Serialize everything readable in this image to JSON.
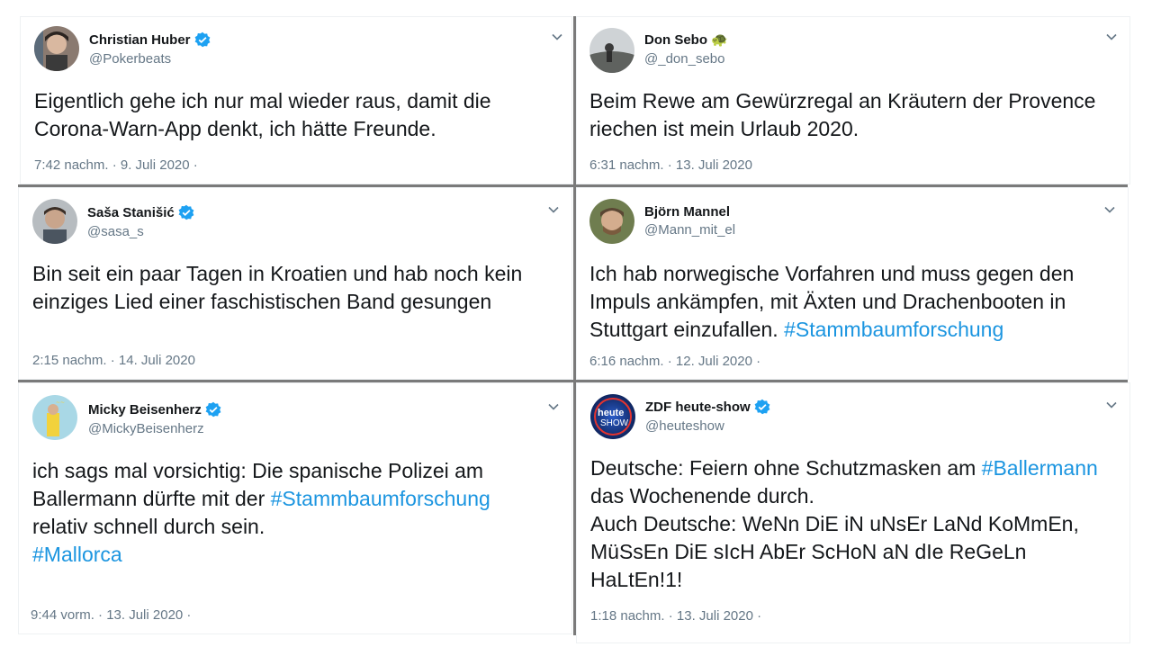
{
  "tweets": [
    {
      "name": "Christian Huber",
      "handle": "@Pokerbeats",
      "verified": true,
      "text_parts": [
        {
          "t": "Eigentlich gehe ich nur mal wieder raus, damit die\nCorona-Warn-App denkt, ich hätte Freunde.",
          "tag": false
        }
      ],
      "time": "7:42 nachm. · 9. Juli 2020 ·"
    },
    {
      "name": "Don Sebo",
      "name_emoji": "🐢",
      "handle": "@_don_sebo",
      "verified": false,
      "text_parts": [
        {
          "t": "Beim Rewe am Gewürzregal an Kräutern der Provence\nriechen ist mein Urlaub 2020.",
          "tag": false
        }
      ],
      "time": "6:31 nachm. · 13. Juli 2020"
    },
    {
      "name": "Saša Stanišić",
      "handle": "@sasa_s",
      "verified": true,
      "text_parts": [
        {
          "t": "Bin seit ein paar Tagen in Kroatien und hab noch kein\neinziges Lied einer faschistischen Band gesungen",
          "tag": false
        }
      ],
      "time": "2:15 nachm. · 14. Juli 2020"
    },
    {
      "name": "Björn Mannel",
      "handle": "@Mann_mit_el",
      "verified": false,
      "text_parts": [
        {
          "t": "Ich hab norwegische Vorfahren und muss gegen den\nImpuls ankämpfen, mit Äxten und Drachenbooten in\nStuttgart einzufallen. ",
          "tag": false
        },
        {
          "t": "#Stammbaumforschung",
          "tag": true
        }
      ],
      "time": "6:16 nachm. · 12. Juli 2020 ·"
    },
    {
      "name": "Micky Beisenherz",
      "handle": "@MickyBeisenherz",
      "verified": true,
      "text_parts": [
        {
          "t": "ich sags mal vorsichtig: Die spanische Polizei am\nBallermann dürfte mit der ",
          "tag": false
        },
        {
          "t": "#Stammbaumforschung",
          "tag": true
        },
        {
          "t": "\nrelativ schnell durch sein.\n",
          "tag": false
        },
        {
          "t": "#Mallorca",
          "tag": true
        }
      ],
      "time": "9:44 vorm. · 13. Juli 2020 ·"
    },
    {
      "name": "ZDF heute-show",
      "handle": "@heuteshow",
      "verified": true,
      "avatar_text": "heute SHOW",
      "text_parts": [
        {
          "t": "Deutsche: Feiern ohne Schutzmasken am ",
          "tag": false
        },
        {
          "t": "#Ballermann",
          "tag": true
        },
        {
          "t": "\ndas Wochenende durch.\nAuch Deutsche: WeNn DiE iN uNsEr LaNd KoMmEn,\nMüSsEn DiE sIcH AbEr ScHoN aN dIe ReGeLn\nHaLtEn!1!",
          "tag": false
        }
      ],
      "time": "1:18 nachm. · 13. Juli 2020 ·"
    }
  ],
  "colors": {
    "hashtag": "#1b95e0",
    "verified": "#1da1f2",
    "muted": "#657786",
    "divider": "#7a7a7a"
  },
  "icons": {
    "verified": "verified-badge-icon",
    "menu": "chevron-down-icon"
  }
}
